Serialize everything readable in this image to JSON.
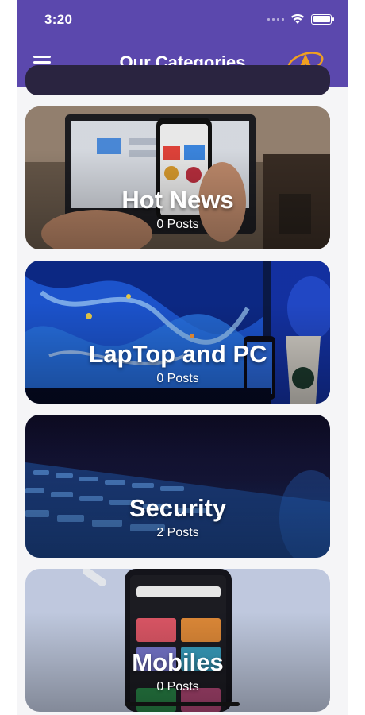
{
  "status_bar": {
    "time": "3:20"
  },
  "header": {
    "title": "Our Categories",
    "menu_icon": "hamburger-menu-icon",
    "logo_icon": "app-logo-icon"
  },
  "colors": {
    "appbar": "#5b48ad",
    "logo_orange": "#f0a020"
  },
  "categories": [
    {
      "name": "Hot News",
      "count": "0 Posts"
    },
    {
      "name": "LapTop and PC",
      "count": "0 Posts"
    },
    {
      "name": "Security",
      "count": "2 Posts"
    },
    {
      "name": "Mobiles",
      "count": "0 Posts"
    }
  ]
}
